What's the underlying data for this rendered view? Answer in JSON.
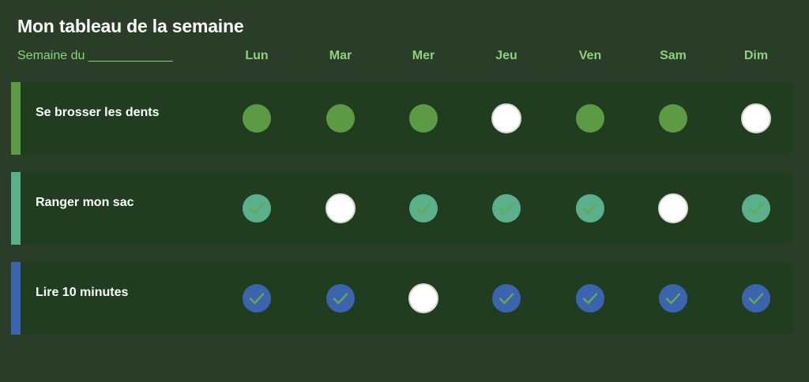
{
  "header": {
    "title": "Mon tableau de la semaine",
    "week_label": "Semaine du ____________"
  },
  "days": [
    "Lun",
    "Mar",
    "Mer",
    "Jeu",
    "Ven",
    "Sam",
    "Dim"
  ],
  "habits": [
    {
      "name": "Se brosser les dents",
      "color": "#5c9a45",
      "done_style": "dot",
      "done": [
        true,
        true,
        true,
        false,
        true,
        true,
        false
      ]
    },
    {
      "name": "Ranger mon sac",
      "color": "#5ab08c",
      "done_style": "check",
      "done": [
        true,
        false,
        true,
        true,
        true,
        false,
        true
      ]
    },
    {
      "name": "Lire 10 minutes",
      "color": "#3a64ad",
      "done_style": "check",
      "done": [
        true,
        true,
        false,
        true,
        true,
        true,
        true
      ]
    }
  ],
  "colors": {
    "background": "#2a3d28",
    "row_background": "#213d1f",
    "accent_text": "#8fd07e",
    "check_mark": "#6aa84f",
    "empty_cell": "#ffffff"
  },
  "icons": {
    "done": "check-icon",
    "pending": "empty-circle"
  }
}
